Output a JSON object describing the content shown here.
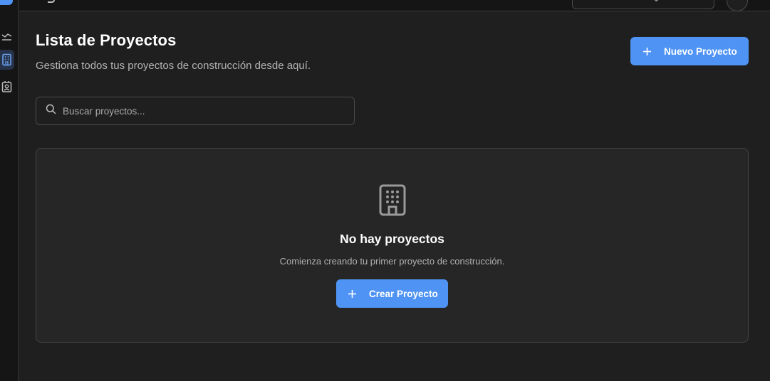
{
  "header": {
    "title": "Lista de Proyectos",
    "subtitle": "Gestiona todos tus proyectos de construcción desde aquí.",
    "new_button_label": "Nuevo Proyecto"
  },
  "search": {
    "placeholder": "Buscar proyectos...",
    "value": ""
  },
  "empty_state": {
    "title": "No hay proyectos",
    "description": "Comienza creando tu primer proyecto de construcción.",
    "button_label": "Crear Proyecto"
  },
  "sidebar": {
    "items": [
      {
        "icon": "chart-icon",
        "active": false
      },
      {
        "icon": "building-icon",
        "active": true
      },
      {
        "icon": "contact-icon",
        "active": false
      }
    ]
  },
  "colors": {
    "accent": "#4f94f4",
    "background": "#1f1f1f",
    "card": "#262626"
  }
}
